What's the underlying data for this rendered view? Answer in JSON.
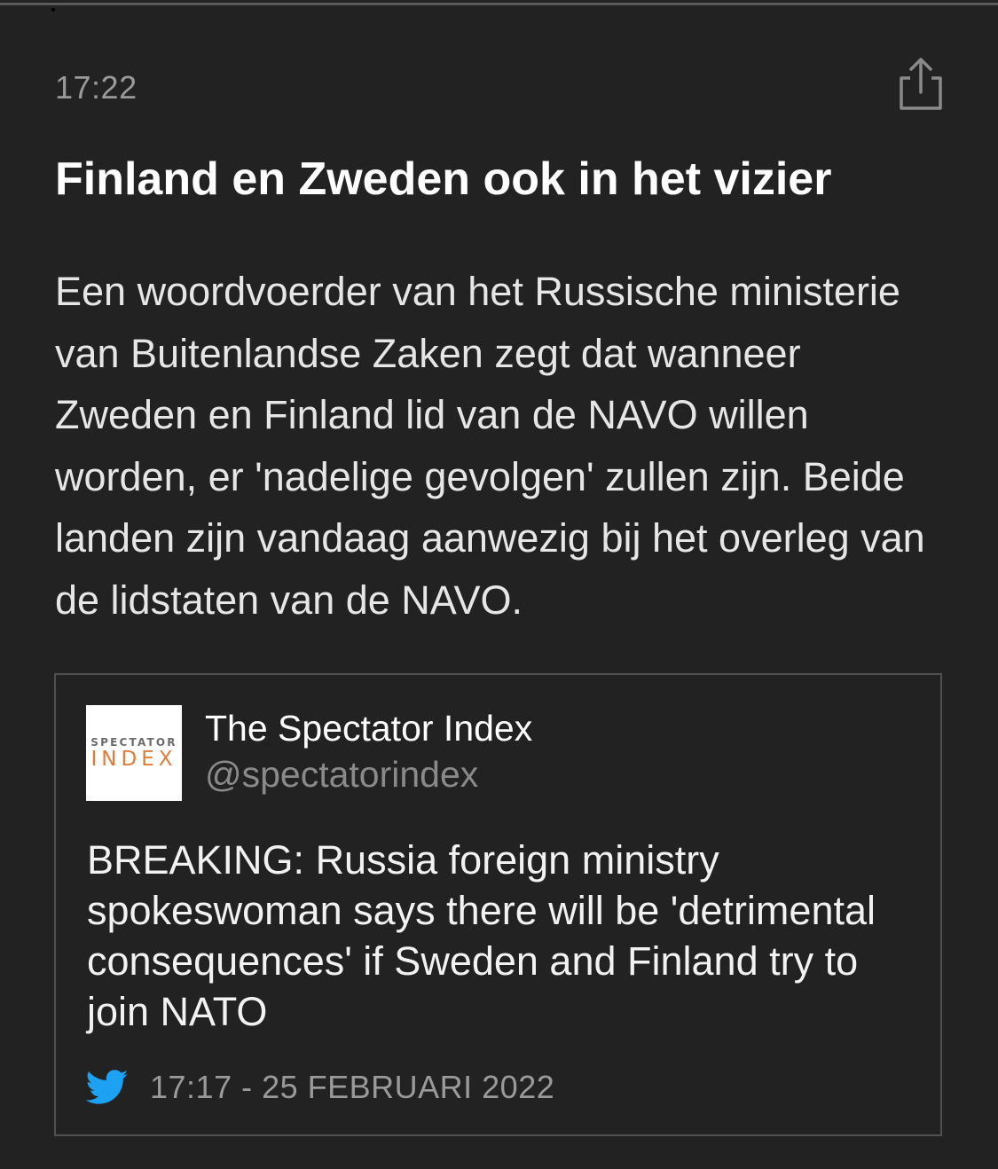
{
  "article": {
    "time": "17:22",
    "headline": "Finland en Zweden ook in het vizier",
    "body": "Een woordvoerder van het Russische ministerie van Buitenlandse Zaken zegt dat wanneer Zweden en Finland lid van de NAVO willen worden, er 'nadelige gevolgen' zullen zijn. Beide landen zijn vandaag aanwezig bij het overleg van de lidstaten van de NAVO.",
    "share_icon": "share-icon"
  },
  "tweet": {
    "avatar_logo_top": "SPECTATOR",
    "avatar_logo_bottom": "INDEX",
    "author_name": "The Spectator Index",
    "author_handle": "@spectatorindex",
    "text": "BREAKING: Russia foreign ministry spokeswoman says there will be 'detrimental consequences' if Sweden and Finland try to join NATO",
    "date": "17:17 - 25 FEBRUARI 2022",
    "source_icon": "twitter-bird-icon"
  },
  "colors": {
    "background": "#222222",
    "muted_text": "#9a9a9a",
    "twitter_blue": "#1da1f2",
    "logo_orange": "#e07d3a"
  }
}
